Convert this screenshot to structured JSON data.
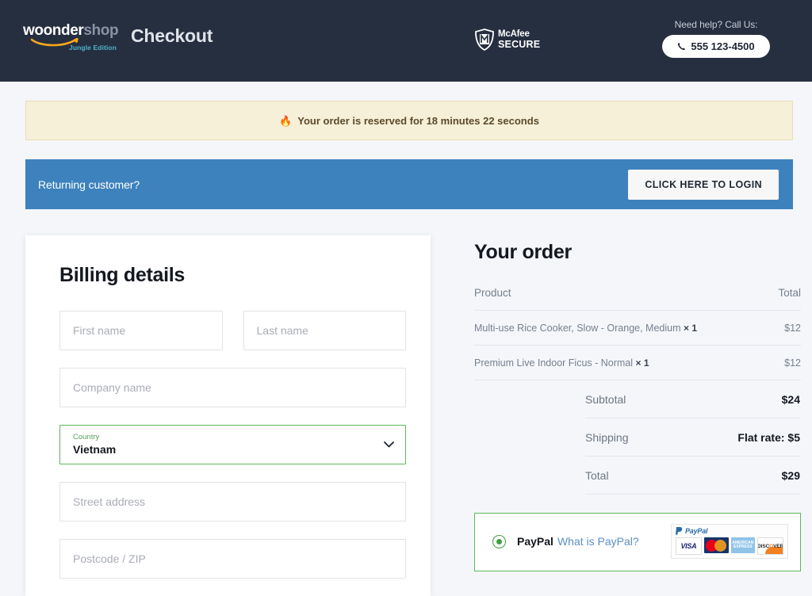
{
  "header": {
    "logo": {
      "brand_primary": "woonder",
      "brand_secondary": "shop",
      "edition": "Jungle Edition",
      "swoosh_color": "#f7a81b",
      "edition_color": "#4fb3c7"
    },
    "page_title": "Checkout",
    "trust_badge": {
      "icon": "shield-icon",
      "line1": "McAfee",
      "line2": "SECURE"
    },
    "help": {
      "label": "Need help? Call Us:",
      "phone_icon": "phone-icon",
      "phone_number": "555 123-4500"
    },
    "background_color": "#262f40"
  },
  "notice": {
    "icon": "flame-icon",
    "glyph": "🔥",
    "text": "Your order is reserved for 18 minutes 22 seconds",
    "background_color": "#f7f0d8",
    "text_color": "#5b4a2b"
  },
  "login_bar": {
    "prompt": "Returning customer?",
    "button_label": "CLICK HERE TO LOGIN",
    "background_color": "#3d82bd"
  },
  "billing": {
    "title": "Billing details",
    "fields": [
      {
        "name": "first-name",
        "placeholder": "First name",
        "value": ""
      },
      {
        "name": "last-name",
        "placeholder": "Last name",
        "value": ""
      },
      {
        "name": "company-name",
        "placeholder": "Company name",
        "value": ""
      },
      {
        "name": "street-address",
        "placeholder": "Street address",
        "value": ""
      },
      {
        "name": "postcode-zip",
        "placeholder": "Postcode / ZIP",
        "value": ""
      }
    ],
    "country_select": {
      "label": "Country",
      "value": "Vietnam",
      "icon": "chevron-down-icon",
      "border_color": "#5cb85c"
    }
  },
  "order": {
    "title": "Your order",
    "columns": [
      "Product",
      "Total"
    ],
    "items": [
      {
        "name": "Multi-use Rice Cooker, Slow - Orange, Medium",
        "quantity": "× 1",
        "total": "$12"
      },
      {
        "name": "Premium Live Indoor Ficus - Normal",
        "quantity": "× 1",
        "total": "$12"
      }
    ],
    "totals": [
      {
        "label": "Subtotal",
        "value": "$24"
      },
      {
        "label": "Shipping",
        "value": "Flat rate: $5"
      },
      {
        "label": "Total",
        "value": "$29"
      }
    ]
  },
  "payment": {
    "selected_method": "PayPal",
    "method_label": "PayPal",
    "info_link": "What is PayPal?",
    "radio_icon": "radio-selected-icon",
    "accent_color": "#5cb85c",
    "card_logos": {
      "paypal_mark": "PayPal",
      "cards": [
        "VISA",
        "MasterCard",
        "AMERICAN EXPRESS",
        "DISCOVER"
      ]
    }
  }
}
